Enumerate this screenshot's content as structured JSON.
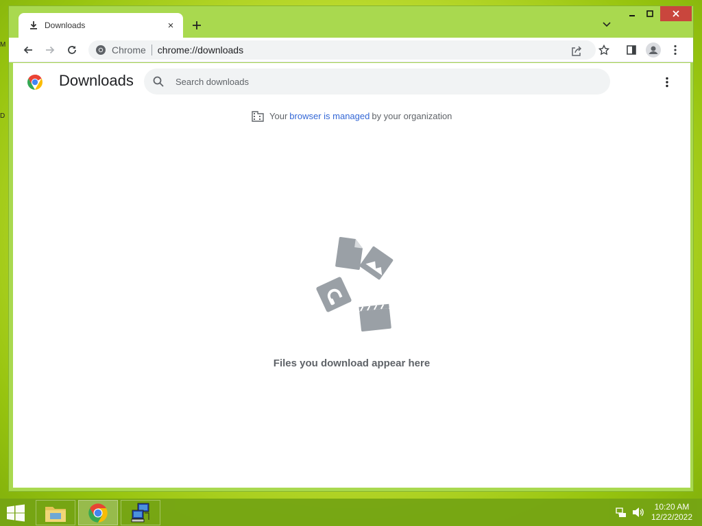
{
  "desktop": {
    "frag1": "M",
    "frag2": "D"
  },
  "tab": {
    "title": "Downloads",
    "close": "×"
  },
  "toolbar": {
    "site_name": "Chrome",
    "url": "chrome://downloads"
  },
  "page": {
    "title": "Downloads",
    "search_placeholder": "Search downloads",
    "managed_prefix": "Your",
    "managed_link": "browser is managed",
    "managed_suffix": "by your organization",
    "empty_message": "Files you download appear here"
  },
  "taskbar": {
    "time": "10:20 AM",
    "date": "12/22/2022"
  },
  "colors": {
    "desktop_accent": "#97c40f",
    "window_frame": "#a9d94f",
    "close_button": "#c9463d",
    "link": "#3367d6",
    "illustration": "#9aa0a6"
  },
  "icons": [
    "download-icon",
    "close-icon",
    "plus-icon",
    "chevron-down-icon",
    "minimize-icon",
    "maximize-icon",
    "back-icon",
    "forward-icon",
    "reload-icon",
    "chrome-icon",
    "share-icon",
    "star-icon",
    "side-panel-icon",
    "profile-icon",
    "more-vert-icon",
    "search-icon",
    "building-icon",
    "windows-start-icon",
    "file-explorer-icon",
    "network-icon",
    "volume-icon"
  ]
}
